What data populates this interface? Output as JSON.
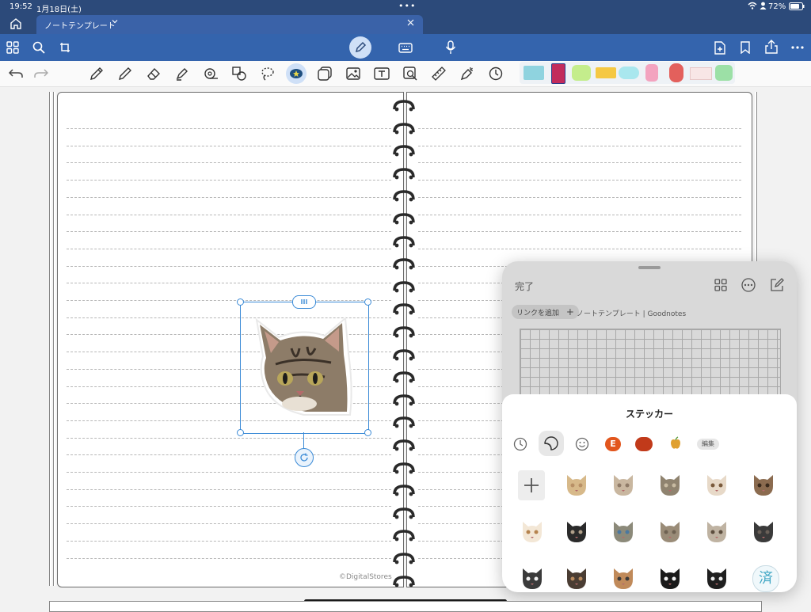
{
  "status": {
    "time": "19:52",
    "date": "1月18日(土)",
    "battery": "72%"
  },
  "tab": {
    "title": "ノートテンプレート"
  },
  "notebook": {
    "watermark": "©DigitalStores"
  },
  "panel": {
    "done_label": "完了",
    "add_link_label": "リンクを追加",
    "link_title": "ノートテンプレート | Goodnotes"
  },
  "stickers": {
    "title": "ステッカー",
    "edit_label": "編集",
    "emoji_e_label": "E",
    "bottom_right_char": "済"
  },
  "colors": {
    "brand": "#2c4a7a",
    "toolbar": "#3464ad",
    "selection": "#3a8ad6"
  }
}
